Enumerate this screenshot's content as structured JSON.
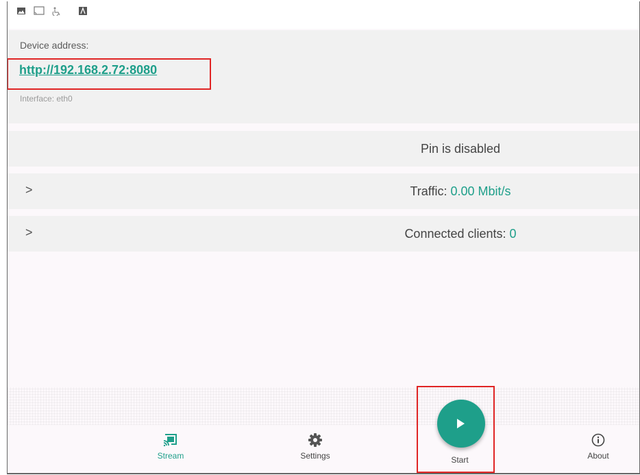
{
  "address": {
    "label": "Device address:",
    "url": "http://192.168.2.72:8080",
    "interface": "Interface: eth0"
  },
  "pin": {
    "text": "Pin is disabled"
  },
  "traffic": {
    "label": "Traffic: ",
    "value": "0.00 Mbit/s"
  },
  "clients": {
    "label": "Connected clients: ",
    "value": "0"
  },
  "nav": {
    "stream": "Stream",
    "settings": "Settings",
    "start": "Start",
    "about": "About"
  },
  "colors": {
    "accent": "#1e9f8a",
    "highlight": "#e02424"
  }
}
